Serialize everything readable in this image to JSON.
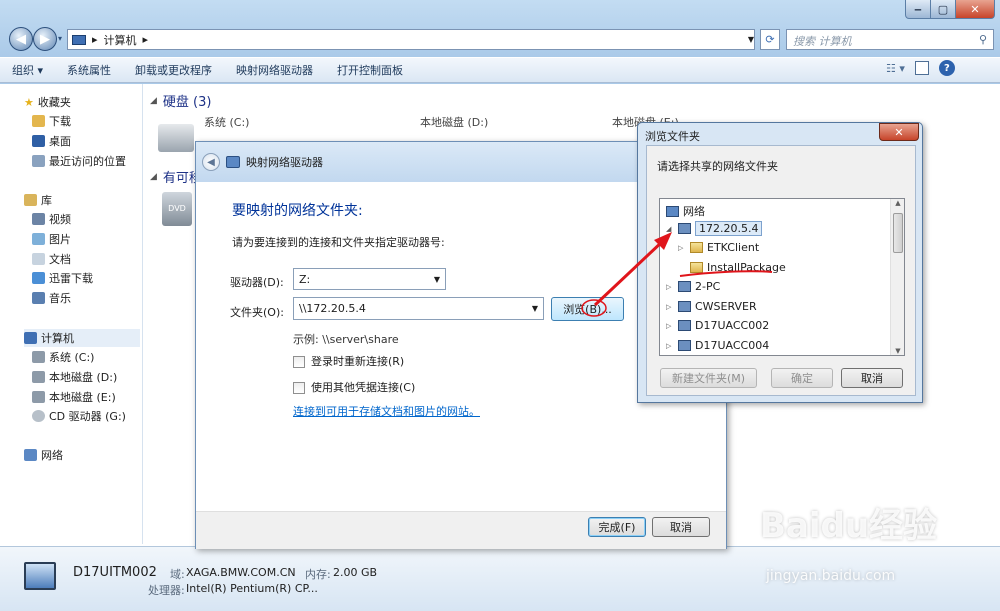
{
  "explorer": {
    "breadcrumb": [
      "计算机"
    ],
    "search_placeholder": "搜索 计算机",
    "toolbar": [
      "组织 ▾",
      "系统属性",
      "卸载或更改程序",
      "映射网络驱动器",
      "打开控制面板"
    ],
    "sidebar": [
      {
        "label": "收藏夹",
        "icon": "star-icon"
      },
      {
        "label": "下载",
        "icon": "folder-icon"
      },
      {
        "label": "桌面",
        "icon": "desktop-icon"
      },
      {
        "label": "最近访问的位置",
        "icon": "recent-icon"
      },
      {
        "label": "库",
        "icon": "library-icon"
      },
      {
        "label": "视频",
        "icon": "video-icon"
      },
      {
        "label": "图片",
        "icon": "picture-icon"
      },
      {
        "label": "文档",
        "icon": "document-icon"
      },
      {
        "label": "迅雷下载",
        "icon": "thunder-icon"
      },
      {
        "label": "音乐",
        "icon": "music-icon"
      },
      {
        "label": "计算机",
        "icon": "computer-icon"
      },
      {
        "label": "系统 (C:)",
        "icon": "drive-icon"
      },
      {
        "label": "本地磁盘 (D:)",
        "icon": "drive-icon"
      },
      {
        "label": "本地磁盘 (E:)",
        "icon": "drive-icon"
      },
      {
        "label": "CD 驱动器 (G:)",
        "icon": "cd-drive-icon"
      },
      {
        "label": "网络",
        "icon": "network-icon"
      }
    ],
    "main": {
      "group_hdd": "硬盘 (3)",
      "drives": [
        "系统 (C:)",
        "本地磁盘 (D:)",
        "本地磁盘 (E:)"
      ],
      "group_removable": "有可移"
    },
    "details": {
      "name": "D17UITM002",
      "domain_label": "域:",
      "domain": "XAGA.BMW.COM.CN",
      "memory_label": "内存:",
      "memory": "2.00 GB",
      "cpu_label": "处理器:",
      "cpu": "Intel(R) Pentium(R) CP..."
    }
  },
  "mapdrive": {
    "title": "映射网络驱动器",
    "heading": "要映射的网络文件夹:",
    "instruction": "请为要连接到的连接和文件夹指定驱动器号:",
    "drive_label": "驱动器(D):",
    "drive_value": "Z:",
    "folder_label": "文件夹(O):",
    "folder_value": "\\\\172.20.5.4",
    "browse": "浏览(B)...",
    "example": "示例: \\\\server\\share",
    "reconnect": "登录时重新连接(R)",
    "other_creds": "使用其他凭据连接(C)",
    "link": "连接到可用于存储文档和图片的网站。",
    "finish": "完成(F)",
    "cancel": "取消"
  },
  "browse": {
    "title": "浏览文件夹",
    "instruction": "请选择共享的网络文件夹",
    "tree": [
      {
        "label": "网络"
      },
      {
        "label": "172.20.5.4"
      },
      {
        "label": "ETKClient"
      },
      {
        "label": "InstallPackage"
      },
      {
        "label": "2-PC"
      },
      {
        "label": "CWSERVER"
      },
      {
        "label": "D17UACC002"
      },
      {
        "label": "D17UACC004"
      }
    ],
    "new_folder": "新建文件夹(M)",
    "ok": "确定",
    "cancel": "取消",
    "close": "✕"
  },
  "watermark": {
    "logo": "Baidu经验",
    "url": "jingyan.baidu.com"
  },
  "colors": {
    "accent": "#003399",
    "annotation": "#e0151b"
  }
}
